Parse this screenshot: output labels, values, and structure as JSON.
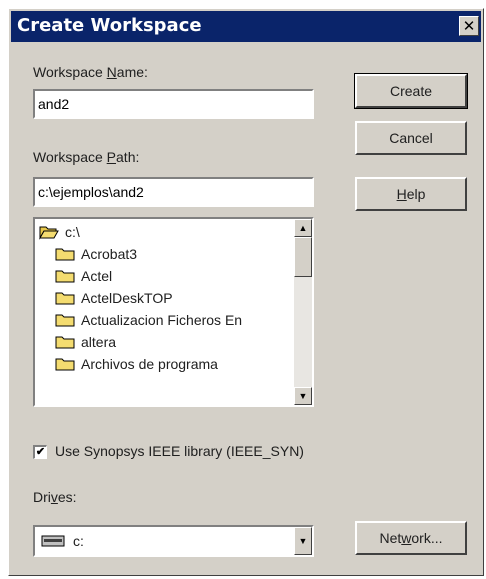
{
  "dialog": {
    "title": "Create Workspace",
    "close_symbol": "✕"
  },
  "workspace_name": {
    "label_pre": "Workspace ",
    "label_key": "N",
    "label_post": "ame:",
    "value": "and2"
  },
  "workspace_path": {
    "label_pre": "Workspace ",
    "label_key": "P",
    "label_post": "ath:",
    "value": "c:\\ejemplos\\and2"
  },
  "directory_tree": {
    "root": {
      "label": "c:\\",
      "icon": "open-folder-icon"
    },
    "items": [
      {
        "label": "Acrobat3",
        "icon": "folder-icon"
      },
      {
        "label": "Actel",
        "icon": "folder-icon"
      },
      {
        "label": "ActelDeskTOP",
        "icon": "folder-icon"
      },
      {
        "label": "Actualizacion Ficheros En",
        "icon": "folder-icon"
      },
      {
        "label": "altera",
        "icon": "folder-icon"
      },
      {
        "label": "Archivos de programa",
        "icon": "folder-icon"
      }
    ],
    "scroll_up_symbol": "▲",
    "scroll_down_symbol": "▼"
  },
  "buttons": {
    "create": "Create",
    "cancel": "Cancel",
    "help_key": "H",
    "help_post": "elp",
    "network_pre": "Net",
    "network_key": "w",
    "network_post": "ork..."
  },
  "ieee_option": {
    "label": "Use Synopsys IEEE library (IEEE_SYN)",
    "checked": true,
    "check_symbol": "✔"
  },
  "drives": {
    "label_pre": "Dri",
    "label_key": "v",
    "label_post": "es:",
    "selected": "c:",
    "icon": "drive-icon",
    "dropdown_symbol": "▼"
  }
}
